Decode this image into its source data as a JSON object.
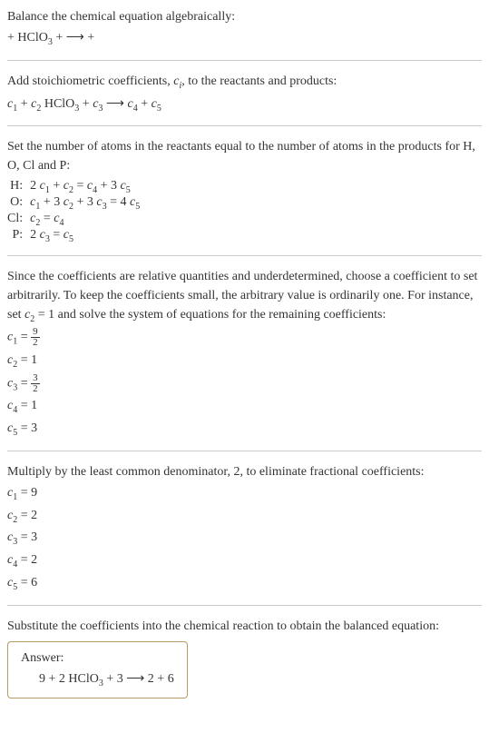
{
  "intro": {
    "line1": "Balance the chemical equation algebraically:",
    "line2_prefix": " + HClO",
    "line2_sub": "3",
    "line2_mid": " +   ⟶   + "
  },
  "stoich": {
    "text": "Add stoichiometric coefficients, ",
    "ci": "c",
    "ci_sub": "i",
    "text2": ", to the reactants and products:",
    "eq_c1": "c",
    "eq_c1s": "1",
    "eq_plus1": "  + ",
    "eq_c2": "c",
    "eq_c2s": "2",
    "eq_hclo": " HClO",
    "eq_hclos": "3",
    "eq_plus2": " + ",
    "eq_c3": "c",
    "eq_c3s": "3",
    "eq_arrow": "   ⟶ ",
    "eq_c4": "c",
    "eq_c4s": "4",
    "eq_plus3": "  + ",
    "eq_c5": "c",
    "eq_c5s": "5"
  },
  "atoms": {
    "text": "Set the number of atoms in the reactants equal to the number of atoms in the products for H, O, Cl and P:",
    "h_label": "H: ",
    "h_eq_a": "2 ",
    "h_c1": "c",
    "h_c1s": "1",
    "h_plus1": " + ",
    "h_c2": "c",
    "h_c2s": "2",
    "h_eq": " = ",
    "h_c4": "c",
    "h_c4s": "4",
    "h_plus2": " + 3 ",
    "h_c5": "c",
    "h_c5s": "5",
    "o_label": "O: ",
    "o_c1": "c",
    "o_c1s": "1",
    "o_plus1": " + 3 ",
    "o_c2": "c",
    "o_c2s": "2",
    "o_plus2": " + 3 ",
    "o_c3": "c",
    "o_c3s": "3",
    "o_eq": " = 4 ",
    "o_c5": "c",
    "o_c5s": "5",
    "cl_label": "Cl: ",
    "cl_c2": "c",
    "cl_c2s": "2",
    "cl_eq": " = ",
    "cl_c4": "c",
    "cl_c4s": "4",
    "p_label": "P: ",
    "p_a": "2 ",
    "p_c3": "c",
    "p_c3s": "3",
    "p_eq": " = ",
    "p_c5": "c",
    "p_c5s": "5"
  },
  "solve": {
    "text1": "Since the coefficients are relative quantities and underdetermined, choose a coefficient to set arbitrarily. To keep the coefficients small, the arbitrary value is ordinarily one. For instance, set ",
    "c2": "c",
    "c2s": "2",
    "text2": " = 1 and solve the system of equations for the remaining coefficients:",
    "r1_c": "c",
    "r1_s": "1",
    "r1_eq": " = ",
    "r1_num": "9",
    "r1_den": "2",
    "r2_c": "c",
    "r2_s": "2",
    "r2_eq": " = 1",
    "r3_c": "c",
    "r3_s": "3",
    "r3_eq": " = ",
    "r3_num": "3",
    "r3_den": "2",
    "r4_c": "c",
    "r4_s": "4",
    "r4_eq": " = 1",
    "r5_c": "c",
    "r5_s": "5",
    "r5_eq": " = 3"
  },
  "multiply": {
    "text": "Multiply by the least common denominator, 2, to eliminate fractional coefficients:",
    "r1_c": "c",
    "r1_s": "1",
    "r1_eq": " = 9",
    "r2_c": "c",
    "r2_s": "2",
    "r2_eq": " = 2",
    "r3_c": "c",
    "r3_s": "3",
    "r3_eq": " = 3",
    "r4_c": "c",
    "r4_s": "4",
    "r4_eq": " = 2",
    "r5_c": "c",
    "r5_s": "5",
    "r5_eq": " = 6"
  },
  "final": {
    "text": "Substitute the coefficients into the chemical reaction to obtain the balanced equation:",
    "answer_label": "Answer:",
    "eq_a": "9  + 2 HClO",
    "eq_sub": "3",
    "eq_b": " + 3   ⟶  2  + 6"
  }
}
